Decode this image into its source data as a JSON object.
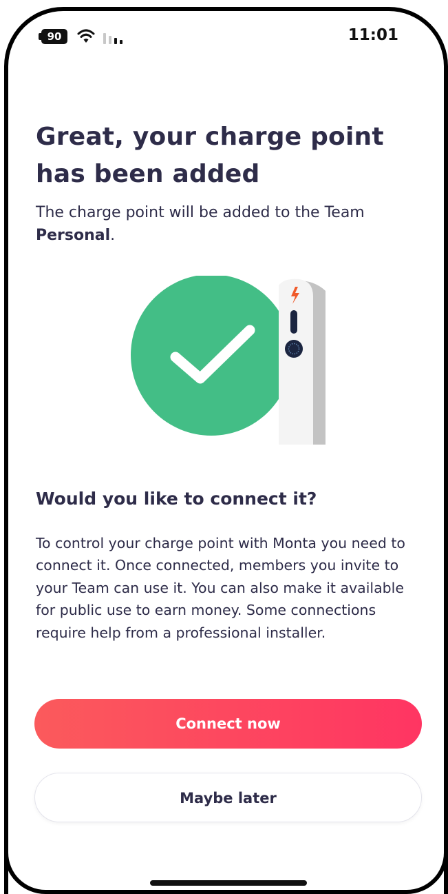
{
  "status_bar": {
    "battery": "90",
    "time": "11:01",
    "icons": [
      "battery-icon",
      "wifi-icon",
      "signal-icon"
    ]
  },
  "title": "Great, your charge point has been added",
  "subtitle": {
    "prefix": "The charge point will be added to the Team ",
    "team": "Personal",
    "suffix": "."
  },
  "illustration": {
    "icon": "charge-point-added-checkmark-icon",
    "colors": {
      "circle": "#43be86",
      "charger_body": "#f4f4f4",
      "charger_side": "#c3c3c3",
      "bolt": "#f05a2a",
      "indicator": "#1b2540"
    }
  },
  "question": "Would you like to connect it?",
  "body": "To control your charge point with Monta you need to connect it. Once connected, members you invite to your Team can use it. You can also make it available for public use to earn money. Some connections require help from a professional installer.",
  "buttons": {
    "primary": "Connect now",
    "secondary": "Maybe later"
  },
  "colors": {
    "text": "#2e2c49",
    "accent_start": "#fb5a5c",
    "accent_end": "#ff3562"
  }
}
